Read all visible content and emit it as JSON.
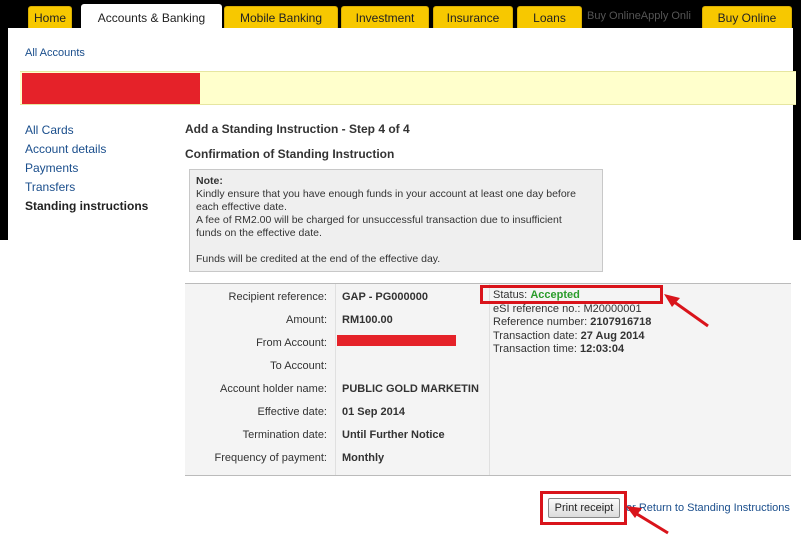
{
  "nav": {
    "tabs": [
      {
        "label": "Home"
      },
      {
        "label": "Accounts & Banking"
      },
      {
        "label": "Mobile Banking"
      },
      {
        "label": "Investment"
      },
      {
        "label": "Insurance"
      },
      {
        "label": "Loans"
      },
      {
        "label": "Buy Online"
      }
    ],
    "overflow_text": "Buy OnlineApply Onli"
  },
  "breadcrumb": {
    "all_accounts": "All Accounts"
  },
  "sidebar": {
    "items": [
      {
        "label": "All Cards"
      },
      {
        "label": "Account details"
      },
      {
        "label": "Payments"
      },
      {
        "label": "Transfers"
      },
      {
        "label": "Standing instructions"
      }
    ]
  },
  "main": {
    "title": "Add a Standing Instruction - Step 4 of 4",
    "subtitle": "Confirmation of Standing Instruction",
    "note": {
      "title": "Note:",
      "line1": "Kindly ensure that you have enough funds in your account at least one day before",
      "line2": "each effective date.",
      "line3": "A fee of RM2.00 will be charged for unsuccessful transaction due to insufficient",
      "line4": "funds on the effective date.",
      "line5": "Funds will be credited at the end of the effective day."
    },
    "details": [
      {
        "label": "Recipient reference:",
        "value": "GAP - PG000000"
      },
      {
        "label": "Amount:",
        "value": "RM100.00"
      },
      {
        "label": "From Account:",
        "value": ""
      },
      {
        "label": "To Account:",
        "value": ""
      },
      {
        "label": "Account holder name:",
        "value": "PUBLIC GOLD MARKETIN"
      },
      {
        "label": "Effective date:",
        "value": "01 Sep 2014"
      },
      {
        "label": "Termination date:",
        "value": "Until Further Notice"
      },
      {
        "label": "Frequency of payment:",
        "value": "Monthly"
      }
    ],
    "status": {
      "status_label": "Status:",
      "status_value": "Accepted",
      "esi_ref": "eSI reference no.: M20000001",
      "ref_label": "Reference number:",
      "ref_value": "2107916718",
      "date_label": "Transaction date:",
      "date_value": "27 Aug 2014",
      "time_label": "Transaction time:",
      "time_value": "12:03:04"
    },
    "actions": {
      "print_receipt": "Print receipt",
      "return_link": "or Return to Standing Instructions"
    }
  },
  "colors": {
    "accent_yellow": "#f7c800",
    "status_green": "#2a9c2a",
    "highlight_red": "#d9141b",
    "link_blue": "#1a4e8c"
  }
}
